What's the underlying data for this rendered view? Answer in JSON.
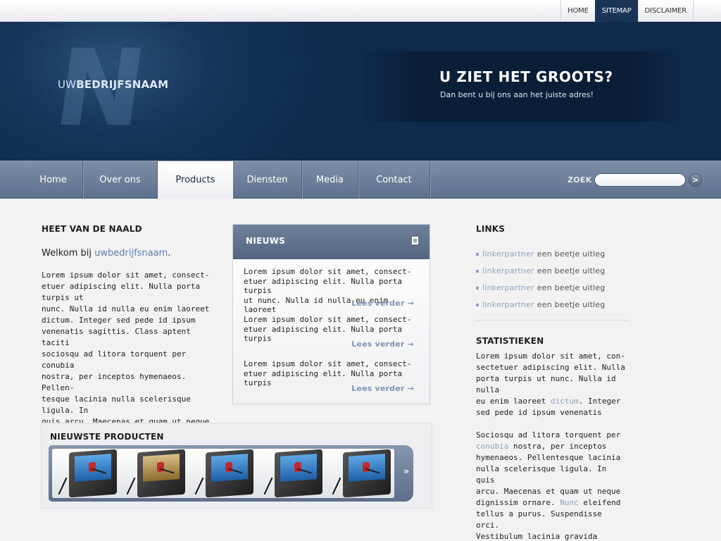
{
  "toplinks": [
    "HOME",
    "SITEMAP",
    "DISCLAIMER"
  ],
  "header": {
    "brand_prefix": "UW",
    "brand_bold": "BEDRIJFSNAAM",
    "logo_letter": "N",
    "promo_title": "U ZIET HET GROOTS?",
    "promo_subtitle": "Dan bent u bij ons aan het juiste adres!"
  },
  "nav": {
    "items": [
      "Home",
      "Over ons",
      "Products",
      "Diensten",
      "Media",
      "Contact"
    ],
    "active": "Products",
    "search_label": "ZOEK",
    "search_value": "",
    "search_button": ">"
  },
  "left": {
    "heading": "HEET VAN DE NAALD",
    "welcome_prefix": "Welkom bij ",
    "welcome_link": "uwbedrijfsnaam",
    "welcome_suffix": ".",
    "body": "Lorem ipsum dolor sit amet, consect-\netuer adipiscing elit. Nulla porta turpis ut\nnunc. Nulla id nulla eu enim laoreet\ndictum. Integer sed pede id ipsum\nvenenatis sagittis. Class aptent taciti\nsociosqu ad litora torquent per conubia\nnostra, per inceptos hymenaeos. Pellen-\ntesque lacinia nulla scelerisque ligula. In\nquis arcu. Maecenas et quam ut neque\ndignissim ornare. Nunc eleifend tellus a\npurus. Suspendisse orci. Vestibulum"
  },
  "news": {
    "title": "NIEUWS",
    "items": [
      {
        "text": "Lorem ipsum dolor sit amet, consect-\netuer adipiscing elit. Nulla porta turpis\nut nunc. Nulla id nulla eu enim laoreet",
        "more": "Lees verder →"
      },
      {
        "text": "Lorem ipsum dolor sit amet, consect-\netuer adipiscing elit. Nulla porta turpis",
        "more": "Lees verder →"
      },
      {
        "text": "Lorem ipsum dolor sit amet, consect-\netuer adipiscing elit. Nulla porta turpis",
        "more": "Lees verder →"
      }
    ]
  },
  "products": {
    "title": "NIEUWSTE PRODUCTEN",
    "arrow": "»",
    "thumb_screens": [
      "blue",
      "gold",
      "blue",
      "blue",
      "blue"
    ]
  },
  "right": {
    "links_title": "LINKS",
    "links": [
      {
        "link": "linkerpartner",
        "desc": "een beetje uitleg"
      },
      {
        "link": "linkerpartner",
        "desc": "een beetje uitleg"
      },
      {
        "link": "linkerpartner",
        "desc": "een beetje uitleg"
      },
      {
        "link": "linkerpartner",
        "desc": "een beetje uitleg"
      }
    ],
    "stats_title": "STATISTIEKEN",
    "p1_a": "Lorem ipsum dolor sit amet, con-\nsectetuer adipiscing elit. Nulla\nporta turpis ut nunc. Nulla id nulla\neu enim laoreet ",
    "p1_link": "dictum",
    "p1_b": ". Integer\nsed pede id ipsum venenatis",
    "p2_a": "Sociosqu ad litora torquent per\n",
    "p2_link1": "conubia",
    "p2_b": " nostra, per inceptos\nhymenaeos. Pellentesque lacinia\nnulla scelerisque ligula. In quis\narcu. Maecenas et quam ut neque\ndignissim ornare. ",
    "p2_link2": "Nunc",
    "p2_c": " eleifend\ntellus a purus. Suspendisse orci.\nVestibulum lacinia gravida nulla."
  }
}
